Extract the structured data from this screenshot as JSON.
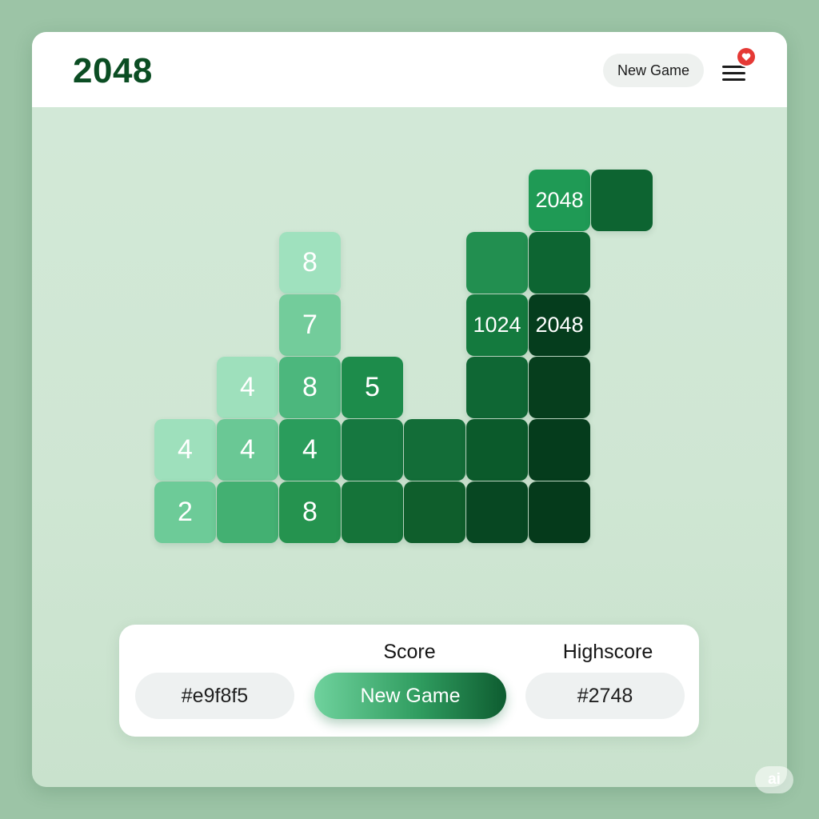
{
  "header": {
    "title": "2048",
    "new_game_label": "New Game",
    "menu_icon": "hamburger-menu-icon",
    "badge_icon": "heart-icon",
    "badge_color": "#e53935"
  },
  "board": {
    "tiles": [
      {
        "id": "r0c6",
        "text": "2048",
        "color": "#1f9a55"
      },
      {
        "id": "r0c7",
        "text": "",
        "color": "#0d6431"
      },
      {
        "id": "r1c2",
        "text": "8",
        "color": "#9fe1be"
      },
      {
        "id": "r1c5",
        "text": "",
        "color": "#228f50"
      },
      {
        "id": "r1c6",
        "text": "",
        "color": "#0d6532"
      },
      {
        "id": "r2c2",
        "text": "7",
        "color": "#73cc9b"
      },
      {
        "id": "r2c5",
        "text": "1024",
        "color": "#147a3e"
      },
      {
        "id": "r2c6",
        "text": "2048",
        "color": "#053d1d"
      },
      {
        "id": "r3c1",
        "text": "4",
        "color": "#9ee0bc"
      },
      {
        "id": "r3c2",
        "text": "8",
        "color": "#4cb77d"
      },
      {
        "id": "r3c3",
        "text": "5",
        "color": "#1d8c4b"
      },
      {
        "id": "r3c5",
        "text": "",
        "color": "#0f6734"
      },
      {
        "id": "r3c6",
        "text": "",
        "color": "#063e1d"
      },
      {
        "id": "r4c0",
        "text": "4",
        "color": "#9ee0bc"
      },
      {
        "id": "r4c1",
        "text": "4",
        "color": "#6ac895"
      },
      {
        "id": "r4c2",
        "text": "4",
        "color": "#2a9d5c"
      },
      {
        "id": "r4c3",
        "text": "",
        "color": "#167840"
      },
      {
        "id": "r4c4",
        "text": "",
        "color": "#136d38"
      },
      {
        "id": "r4c5",
        "text": "",
        "color": "#0b5a2b"
      },
      {
        "id": "r4c6",
        "text": "",
        "color": "#053c1c"
      },
      {
        "id": "r5c0",
        "text": "2",
        "color": "#6dcb98"
      },
      {
        "id": "r5c1",
        "text": "",
        "color": "#43b072"
      },
      {
        "id": "r5c2",
        "text": "8",
        "color": "#25934f"
      },
      {
        "id": "r5c3",
        "text": "",
        "color": "#157339"
      },
      {
        "id": "r5c4",
        "text": "",
        "color": "#0f5e2c"
      },
      {
        "id": "r5c5",
        "text": "",
        "color": "#074722"
      },
      {
        "id": "r5c6",
        "text": "",
        "color": "#053a1b"
      }
    ]
  },
  "scoreboard": {
    "left_value": "#e9f8f5",
    "score_label": "Score",
    "new_game_label": "New Game",
    "highscore_label": "Highscore",
    "highscore_value": "#2748"
  },
  "watermark": {
    "text": "ai"
  }
}
